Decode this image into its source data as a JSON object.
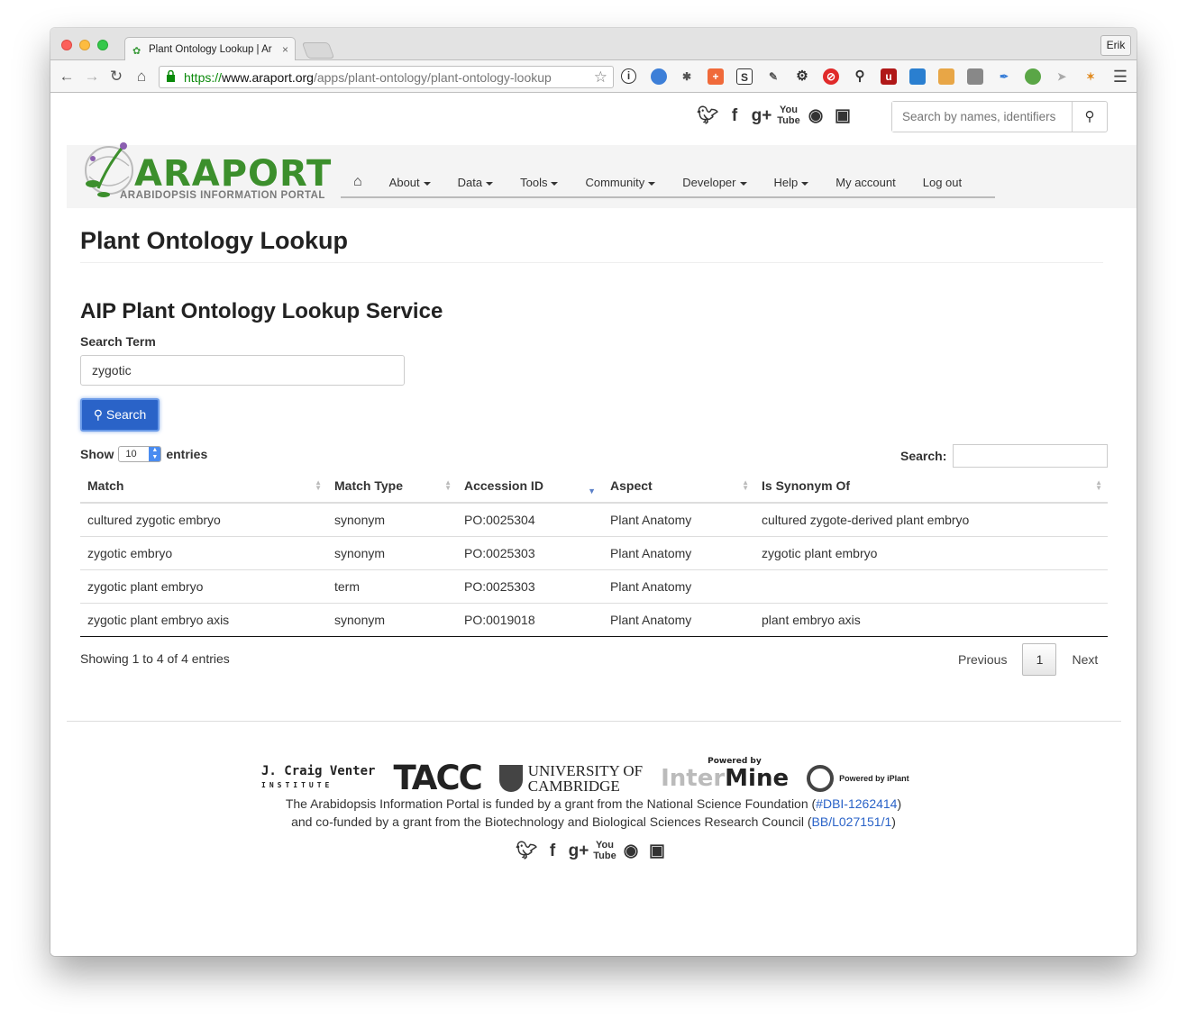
{
  "browser": {
    "tab_title": "Plant Ontology Lookup | Ar",
    "tab_close": "×",
    "user_button": "Erik",
    "url_scheme": "https://",
    "url_host": "www.araport.org",
    "url_path": "/apps/plant-ontology/plant-ontology-lookup"
  },
  "header": {
    "social_icons": [
      "twitter-icon",
      "facebook-icon",
      "google-plus-icon",
      "youtube-icon",
      "github-icon",
      "slideshare-icon"
    ],
    "search_placeholder": "Search by names, identifiers"
  },
  "logo": {
    "word": "ARAPORT",
    "tagline": "ARABIDOPSIS INFORMATION PORTAL"
  },
  "nav": {
    "items": [
      "About",
      "Data",
      "Tools",
      "Community",
      "Developer",
      "Help",
      "My account",
      "Log out"
    ]
  },
  "page": {
    "title": "Plant Ontology Lookup",
    "service_title": "AIP Plant Ontology Lookup Service",
    "search_term_label": "Search Term",
    "search_term_value": "zygotic",
    "search_button": "Search"
  },
  "table_controls": {
    "show_label": "Show",
    "page_length": "10",
    "entries_label": "entries",
    "filter_label": "Search:"
  },
  "table": {
    "columns": [
      "Match",
      "Match Type",
      "Accession ID",
      "Aspect",
      "Is Synonym Of"
    ],
    "sorted_column": "Accession ID",
    "rows": [
      [
        "cultured zygotic embryo",
        "synonym",
        "PO:0025304",
        "Plant Anatomy",
        "cultured zygote-derived plant embryo"
      ],
      [
        "zygotic embryo",
        "synonym",
        "PO:0025303",
        "Plant Anatomy",
        "zygotic plant embryo"
      ],
      [
        "zygotic plant embryo",
        "term",
        "PO:0025303",
        "Plant Anatomy",
        ""
      ],
      [
        "zygotic plant embryo axis",
        "synonym",
        "PO:0019018",
        "Plant Anatomy",
        "plant embryo axis"
      ]
    ]
  },
  "pagination": {
    "info": "Showing 1 to 4 of 4 entries",
    "previous": "Previous",
    "current": "1",
    "next": "Next"
  },
  "footer": {
    "partners": {
      "jcvi": "J. Craig Venter",
      "jcvi_sub": "INSTITUTE",
      "tacc": "TACC",
      "cambridge_line1": "UNIVERSITY OF",
      "cambridge_line2": "CAMBRIDGE",
      "intermine_powered": "Powered by",
      "intermine_inter": "Inter",
      "intermine_mine": "Mine",
      "iplant": "Powered by iPlant"
    },
    "funding_line1_pre": "The Arabidopsis Information Portal is funded by a grant from the National Science Foundation (",
    "funding_line1_link": "#DBI-1262414",
    "funding_line1_post": ")",
    "funding_line2_pre": "and co-funded by a grant from the Biotechnology and Biological Sciences Research Council (",
    "funding_line2_link": "BB/L027151/1",
    "funding_line2_post": ")"
  },
  "colors": {
    "brand_green": "#3c8f2c",
    "button_blue": "#2a63c8",
    "link_blue": "#2a63c8"
  }
}
